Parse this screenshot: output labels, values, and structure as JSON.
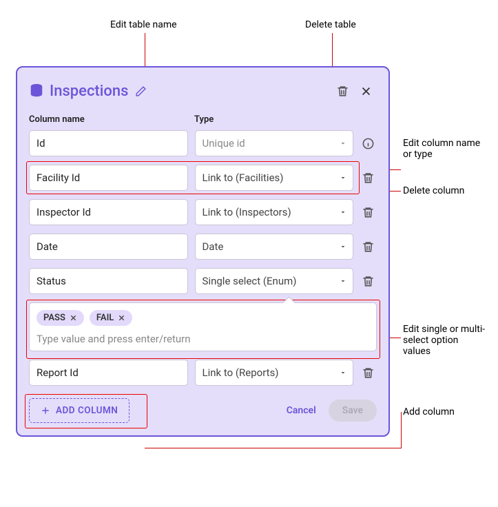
{
  "annotations": {
    "edit_table_name": "Edit table name",
    "delete_table": "Delete table",
    "edit_column": "Edit column name or type",
    "delete_column": "Delete column",
    "edit_enum": "Edit single or multi-select option values",
    "add_column": "Add column"
  },
  "panel": {
    "title": "Inspections"
  },
  "headers": {
    "name": "Column name",
    "type": "Type"
  },
  "rows": [
    {
      "name": "Id",
      "type": "Unique id",
      "locked": true
    },
    {
      "name": "Facility Id",
      "type": "Link to (Facilities)",
      "locked": false
    },
    {
      "name": "Inspector Id",
      "type": "Link to (Inspectors)",
      "locked": false
    },
    {
      "name": "Date",
      "type": "Date",
      "locked": false
    },
    {
      "name": "Status",
      "type": "Single select (Enum)",
      "locked": false
    },
    {
      "name": "Report Id",
      "type": "Link to (Reports)",
      "locked": false
    }
  ],
  "enum": {
    "options": [
      "PASS",
      "FAIL"
    ],
    "placeholder": "Type value and press enter/return"
  },
  "footer": {
    "add_column": "ADD COLUMN",
    "cancel": "Cancel",
    "save": "Save"
  }
}
